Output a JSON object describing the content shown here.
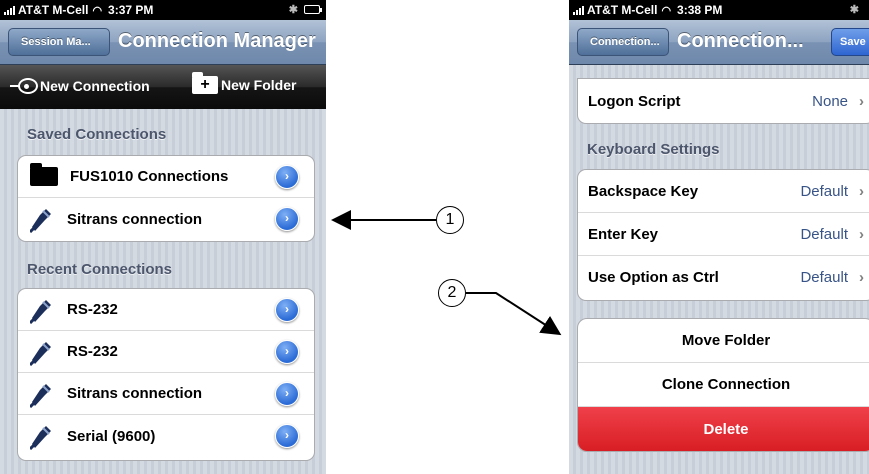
{
  "left": {
    "status": {
      "carrier": "AT&T M-Cell",
      "time": "3:37 PM"
    },
    "nav": {
      "back_label": "Session Ma...",
      "title": "Connection Manager"
    },
    "toolbar": {
      "new_connection": "New Connection",
      "new_folder": "New Folder"
    },
    "saved_header": "Saved Connections",
    "saved": [
      {
        "label": "FUS1010 Connections",
        "icon": "folder-icon"
      },
      {
        "label": "Sitrans connection",
        "icon": "serial-plug-icon"
      }
    ],
    "recent_header": "Recent Connections",
    "recent": [
      {
        "label": "RS-232",
        "icon": "serial-plug-icon"
      },
      {
        "label": "RS-232",
        "icon": "serial-plug-icon"
      },
      {
        "label": "Sitrans connection",
        "icon": "serial-plug-icon"
      },
      {
        "label": "Serial (9600)",
        "icon": "serial-plug-icon"
      }
    ]
  },
  "right": {
    "status": {
      "carrier": "AT&T M-Cell",
      "time": "3:38 PM"
    },
    "nav": {
      "back_label": "Connection...",
      "title": "Connection...",
      "save_label": "Save"
    },
    "logon": {
      "label": "Logon Script",
      "value": "None"
    },
    "keyboard_header": "Keyboard Settings",
    "keyboard": [
      {
        "label": "Backspace Key",
        "value": "Default"
      },
      {
        "label": "Enter Key",
        "value": "Default"
      },
      {
        "label": "Use Option as Ctrl",
        "value": "Default"
      }
    ],
    "actions": {
      "move": "Move Folder",
      "clone": "Clone Connection",
      "delete": "Delete"
    }
  },
  "callouts": {
    "one": "1",
    "two": "2"
  },
  "colors": {
    "delete_red": "#e02a30",
    "nav_blue": "#7a93b4",
    "disclosure_blue": "#2b6bd6"
  }
}
